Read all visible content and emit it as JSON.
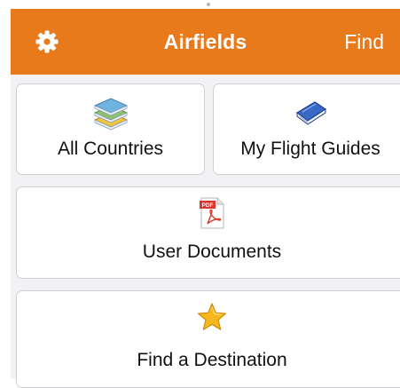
{
  "header": {
    "title": "Airfields",
    "find_label": "Find",
    "settings_icon": "gear-icon",
    "bar_color": "#e87a1b"
  },
  "tiles": [
    {
      "label": "All Countries",
      "icon": "stacked-books-icon"
    },
    {
      "label": "My Flight Guides",
      "icon": "book-icon"
    },
    {
      "label": "User Documents",
      "icon": "pdf-file-icon",
      "icon_badge": "PDF"
    },
    {
      "label": "Find a Destination",
      "icon": "star-icon"
    }
  ]
}
